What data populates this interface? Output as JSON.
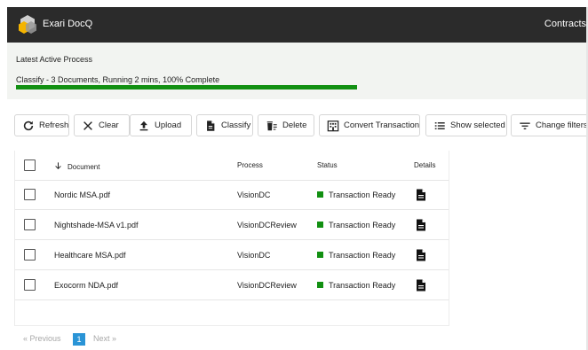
{
  "header": {
    "app_title": "Exari DocQ",
    "right_label": "Contracts"
  },
  "process": {
    "title": "Latest Active Process",
    "status": "Classify - 3 Documents, Running 2 mins, 100% Complete",
    "progress_percent": 100,
    "progress_color": "#129012"
  },
  "toolbar": {
    "refresh": "Refresh",
    "clear": "Clear",
    "upload": "Upload",
    "classify": "Classify",
    "delete": "Delete",
    "convert": "Convert Transaction",
    "show_selected": "Show selected",
    "change_filters": "Change filters"
  },
  "table": {
    "columns": {
      "document": "Document",
      "process": "Process",
      "status": "Status",
      "details": "Details"
    },
    "sort_icon": "arrow-down-icon",
    "rows": [
      {
        "document": "Nordic MSA.pdf",
        "process": "VisionDC",
        "status": "Transaction Ready"
      },
      {
        "document": "Nightshade-MSA v1.pdf",
        "process": "VisionDCReview",
        "status": "Transaction Ready"
      },
      {
        "document": "Healthcare MSA.pdf",
        "process": "VisionDC",
        "status": "Transaction Ready"
      },
      {
        "document": "Exocorm NDA.pdf",
        "process": "VisionDCReview",
        "status": "Transaction Ready"
      }
    ],
    "status_color": "#129012"
  },
  "pagination": {
    "previous": "« Previous",
    "current": "1",
    "next": "Next »",
    "active_color": "#2a94d6"
  }
}
